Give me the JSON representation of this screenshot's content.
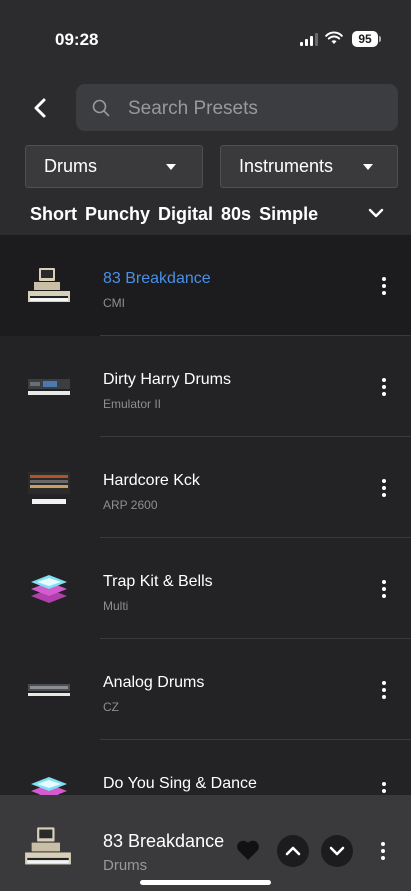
{
  "status": {
    "time": "09:28",
    "battery": "95"
  },
  "search": {
    "placeholder": "Search Presets"
  },
  "filters": {
    "category": "Drums",
    "type": "Instruments"
  },
  "tags": [
    "Short",
    "Punchy",
    "Digital",
    "80s",
    "Simple"
  ],
  "presets": [
    {
      "name": "83 Breakdance",
      "instrument": "CMI",
      "active": true,
      "thumb": "cmi"
    },
    {
      "name": "Dirty Harry Drums",
      "instrument": "Emulator II",
      "active": false,
      "thumb": "emulator"
    },
    {
      "name": "Hardcore Kck",
      "instrument": "ARP 2600",
      "active": false,
      "thumb": "arp"
    },
    {
      "name": "Trap Kit & Bells",
      "instrument": "Multi",
      "active": false,
      "thumb": "multi"
    },
    {
      "name": "Analog Drums",
      "instrument": "CZ",
      "active": false,
      "thumb": "cz"
    },
    {
      "name": "Do You Sing & Dance",
      "instrument": "",
      "active": false,
      "thumb": "multi"
    }
  ],
  "player": {
    "name": "83 Breakdance",
    "category": "Drums"
  },
  "colors": {
    "active": "#4a8fe7",
    "background": "#232325",
    "header": "#2c2c2e",
    "player": "#3a3a3c"
  }
}
